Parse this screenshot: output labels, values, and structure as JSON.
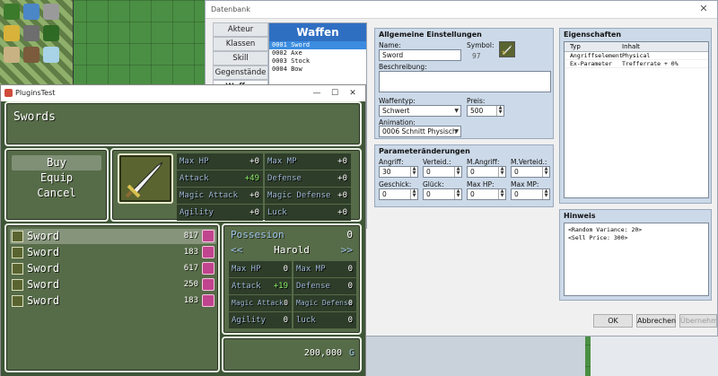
{
  "database": {
    "title": "Datenbank",
    "tabs": [
      "Akteur",
      "Klassen",
      "Skill",
      "Gegenstände",
      "Waffen"
    ],
    "list_header": "Waffen",
    "weapons": [
      "0001 Sword",
      "0002 Axe",
      "0003 Stock",
      "0004 Bow"
    ],
    "general": {
      "title": "Allgemeine Einstellungen",
      "name_label": "Name:",
      "name_value": "Sword",
      "icon_label": "Symbol:",
      "icon_index": "97",
      "desc_label": "Beschreibung:",
      "weapon_type_label": "Waffentyp:",
      "weapon_type_value": "Schwert",
      "price_label": "Preis:",
      "price_value": "500",
      "animation_label": "Animation:",
      "animation_value": "0006 Schnitt Physisch"
    },
    "params": {
      "title": "Parameteränderungen",
      "fields": [
        {
          "label": "Angriff:",
          "value": "30"
        },
        {
          "label": "Verteid.:",
          "value": "0"
        },
        {
          "label": "M.Angriff:",
          "value": "0"
        },
        {
          "label": "M.Verteid.:",
          "value": "0"
        },
        {
          "label": "Geschick:",
          "value": "0"
        },
        {
          "label": "Glück:",
          "value": "0"
        },
        {
          "label": "Max HP:",
          "value": "0"
        },
        {
          "label": "Max MP:",
          "value": "0"
        }
      ]
    },
    "traits": {
      "title": "Eigenschaften",
      "col_type": "Typ",
      "col_content": "Inhalt",
      "rows": [
        {
          "type": "Angriffselement",
          "content": "Physical"
        },
        {
          "type": "Ex-Parameter",
          "content": "Trefferrate + 0%"
        }
      ]
    },
    "note": {
      "title": "Hinweis",
      "lines": [
        "<Random Variance: 20>",
        "<Sell Price: 300>"
      ]
    },
    "buttons": {
      "ok": "OK",
      "cancel": "Abbrechen",
      "apply": "Übernehmen"
    }
  },
  "game": {
    "window_title": "PluginsTest",
    "category": "Swords",
    "commands": [
      "Buy",
      "Equip",
      "Cancel"
    ],
    "compare_stats": [
      {
        "name": "Max HP",
        "value": "+0"
      },
      {
        "name": "Max MP",
        "value": "+0"
      },
      {
        "name": "Attack",
        "value": "+49"
      },
      {
        "name": "Defense",
        "value": "+0"
      },
      {
        "name": "Magic Attack",
        "value": "+0"
      },
      {
        "name": "Magic Defense",
        "value": "+0"
      },
      {
        "name": "Agility",
        "value": "+0"
      },
      {
        "name": "Luck",
        "value": "+0"
      }
    ],
    "items": [
      {
        "name": "Sword",
        "qty": "817"
      },
      {
        "name": "Sword",
        "qty": "183"
      },
      {
        "name": "Sword",
        "qty": "617"
      },
      {
        "name": "Sword",
        "qty": "250"
      },
      {
        "name": "Sword",
        "qty": "183"
      }
    ],
    "possession_label": "Possesion",
    "possession_value": "0",
    "actor_prev": "<<",
    "actor_name": "Harold",
    "actor_next": ">>",
    "actor_stats": [
      {
        "name": "Max HP",
        "value": "0"
      },
      {
        "name": "Max MP",
        "value": "0"
      },
      {
        "name": "Attack",
        "value": "+19"
      },
      {
        "name": "Defense",
        "value": "0"
      },
      {
        "name": "Magic Attack",
        "value": "0"
      },
      {
        "name": "Magic Defense",
        "value": "0"
      },
      {
        "name": "Agility",
        "value": "0"
      },
      {
        "name": "luck",
        "value": "0"
      }
    ],
    "gold": "200,000",
    "gold_unit": "G"
  }
}
